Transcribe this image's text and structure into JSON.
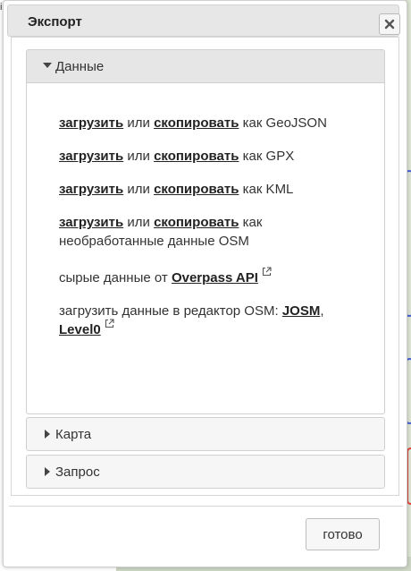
{
  "background": {
    "edge_text": "il"
  },
  "dialog": {
    "title": "Экспорт",
    "close_icon": "close-icon",
    "sections": [
      {
        "label": "Данные",
        "expanded": true
      },
      {
        "label": "Карта",
        "expanded": false
      },
      {
        "label": "Запрос",
        "expanded": false
      }
    ],
    "data_section": {
      "geojson": {
        "download": "загрузить",
        "or": "или",
        "copy": "скопировать",
        "suffix": "как GeoJSON"
      },
      "gpx": {
        "download": "загрузить",
        "or": "или",
        "copy": "скопировать",
        "suffix": "как GPX"
      },
      "kml": {
        "download": "загрузить",
        "or": "или",
        "copy": "скопировать",
        "suffix": "как KML"
      },
      "osm": {
        "download": "загрузить",
        "or": "или",
        "copy": "скопировать",
        "suffix": "как",
        "suffix2": "необработанные данные OSM"
      },
      "raw": {
        "prefix": "сырые данные от",
        "link": "Overpass API"
      },
      "editor": {
        "prefix": "загрузить данные в редактор OSM:",
        "josm": "JOSM",
        "comma": ",",
        "level0": "Level0"
      }
    },
    "done_label": "готово"
  },
  "colors": {
    "title_bg": "#e7e7e7",
    "map_line": "#4a62d8",
    "map_line2": "#e0463c"
  }
}
